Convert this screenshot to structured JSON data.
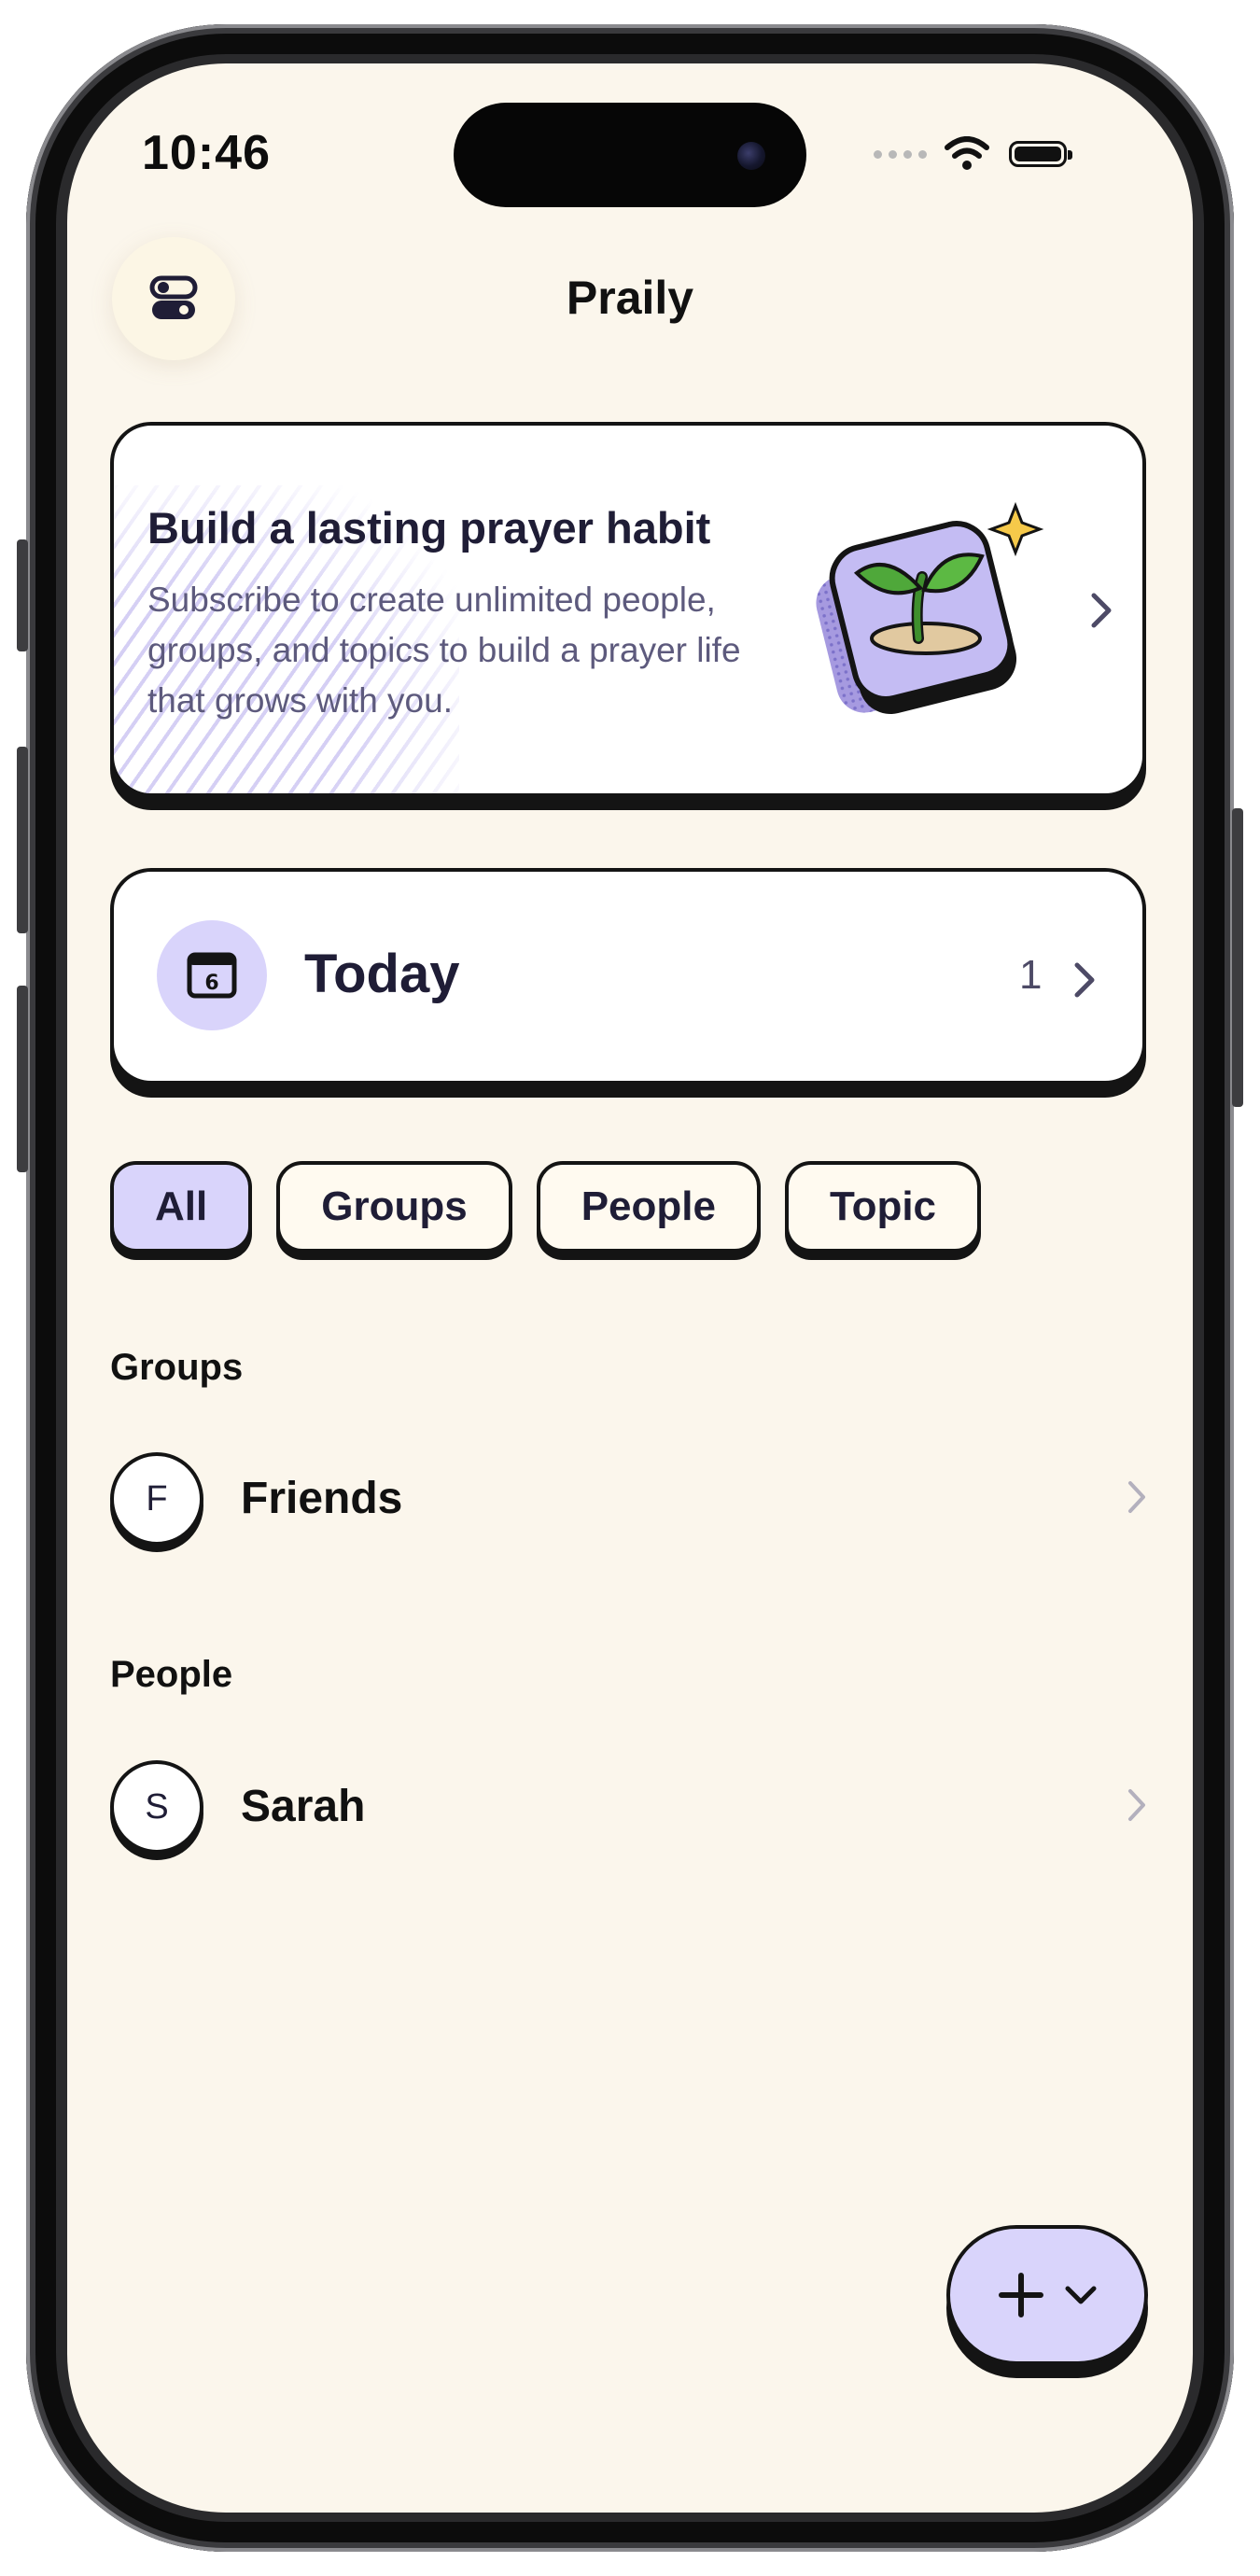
{
  "status_bar": {
    "time": "10:46"
  },
  "nav": {
    "title": "Praily",
    "settings_icon": "toggles-icon"
  },
  "promo": {
    "title": "Build a lasting prayer habit",
    "text": "Subscribe to create unlimited people, groups, and topics to build a prayer life that grows with you.",
    "art": "sprout-illustration"
  },
  "today": {
    "label": "Today",
    "count": "1",
    "icon_day": "6"
  },
  "filters": [
    {
      "label": "All",
      "active": true
    },
    {
      "label": "Groups",
      "active": false
    },
    {
      "label": "People",
      "active": false
    },
    {
      "label": "Topic",
      "active": false
    }
  ],
  "sections": {
    "groups": {
      "title": "Groups",
      "items": [
        {
          "initial": "F",
          "name": "Friends"
        }
      ]
    },
    "people": {
      "title": "People",
      "items": [
        {
          "initial": "S",
          "name": "Sarah"
        }
      ]
    }
  },
  "colors": {
    "background": "#fbf6ec",
    "accent": "#d9d4fb",
    "ink": "#141414",
    "text_primary": "#1f1d36",
    "text_secondary": "#5d5a7d"
  }
}
